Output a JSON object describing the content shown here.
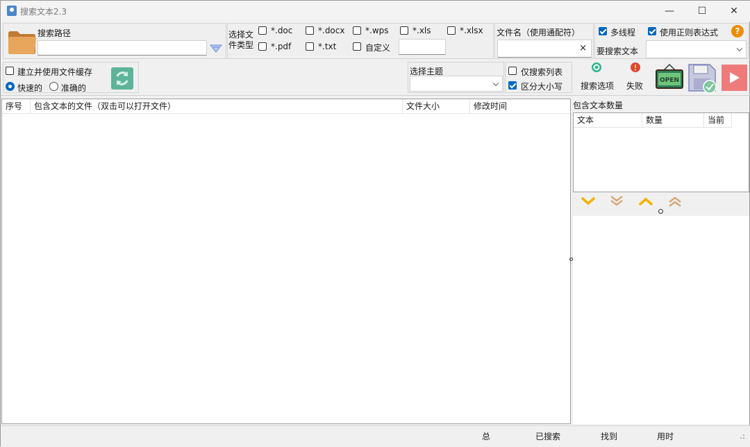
{
  "window": {
    "title": "搜索文本2.3",
    "minimize": "—",
    "maximize": "☐",
    "close": "✕"
  },
  "path": {
    "label": "搜索路径",
    "value": ""
  },
  "filetypes": {
    "label": "选择文件类型",
    "options": [
      {
        "label": "*.doc",
        "checked": false
      },
      {
        "label": "*.docx",
        "checked": false
      },
      {
        "label": "*.wps",
        "checked": false
      },
      {
        "label": "*.xls",
        "checked": false
      },
      {
        "label": "*.xlsx",
        "checked": false
      },
      {
        "label": "*.pdf",
        "checked": false
      },
      {
        "label": "*.txt",
        "checked": false
      },
      {
        "label": "自定义",
        "checked": false
      }
    ],
    "custom_value": ""
  },
  "filename": {
    "label": "文件名（使用通配符）",
    "value": "",
    "clear": "×"
  },
  "options": {
    "multithread": {
      "label": "多线程",
      "checked": true
    },
    "regex": {
      "label": "使用正则表达式",
      "checked": true
    },
    "search_text_label": "要搜索文本",
    "search_text_value": "",
    "help": "?"
  },
  "cache": {
    "label": "建立并使用文件缓存",
    "checked": false,
    "fast": {
      "label": "快速的",
      "checked": true
    },
    "accurate": {
      "label": "准确的",
      "checked": false
    }
  },
  "theme": {
    "label": "选择主题",
    "value": ""
  },
  "search_flags": {
    "only_list": {
      "label": "仅搜索列表",
      "checked": false
    },
    "case": {
      "label": "区分大小写",
      "checked": true
    }
  },
  "toolbar": {
    "search_options": "搜索选项",
    "fail": "失败",
    "open_sign": "OPEN"
  },
  "results": {
    "columns": [
      "序号",
      "包含文本的文件（双击可以打开文件）",
      "文件大小",
      "修改时间"
    ],
    "rows": []
  },
  "count_panel": {
    "title": "包含文本数量",
    "columns": [
      "文本",
      "数量",
      "当前"
    ],
    "rows": []
  },
  "statusbar": {
    "total": "总",
    "searched": "已搜索",
    "found": "找到",
    "elapsed": "用时"
  },
  "colors": {
    "accent": "#0067c0",
    "folder": "#e8a55c",
    "nav_arrow": "#f2b100",
    "nav_arrow_muted": "#d9a777",
    "play": "#ef7a7a"
  }
}
